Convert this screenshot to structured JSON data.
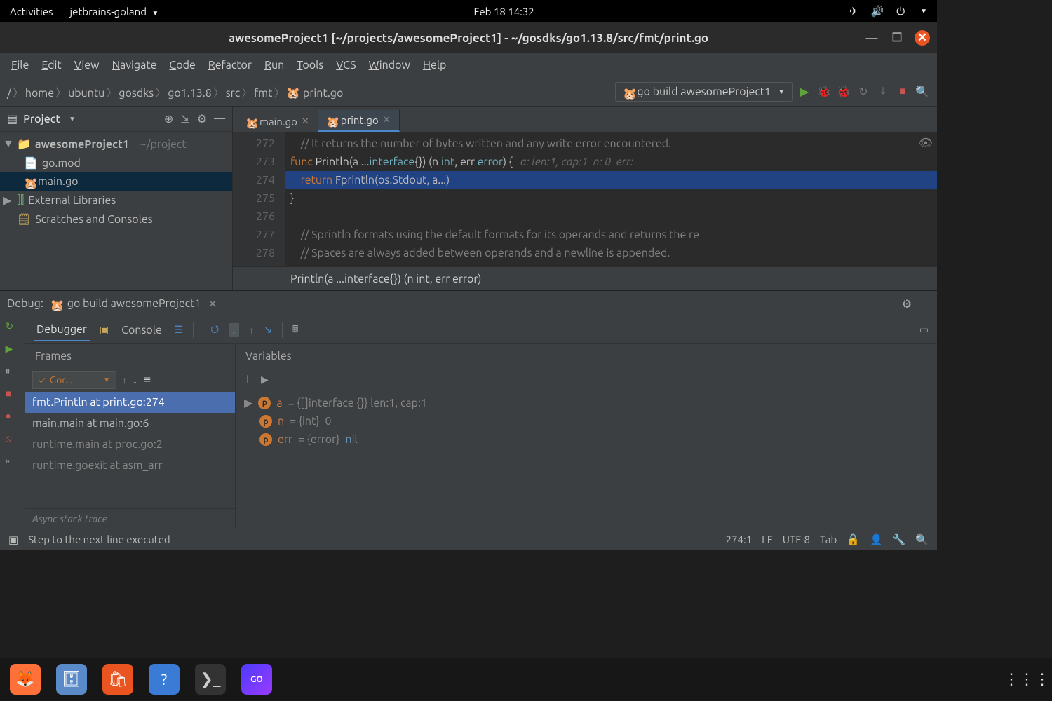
{
  "gnome": {
    "activities": "Activities",
    "app": "jetbrains-goland",
    "clock": "Feb 18  14:32"
  },
  "window": {
    "title": "awesomeProject1 [~/projects/awesomeProject1] - ~/gosdks/go1.13.8/src/fmt/print.go"
  },
  "menu": [
    "File",
    "Edit",
    "View",
    "Navigate",
    "Code",
    "Refactor",
    "Run",
    "Tools",
    "VCS",
    "Window",
    "Help"
  ],
  "breadcrumbs": [
    "/",
    "home",
    "ubuntu",
    "gosdks",
    "go1.13.8",
    "src",
    "fmt",
    "print.go"
  ],
  "runConfig": "go build awesomeProject1",
  "projectPanel": {
    "title": "Project"
  },
  "tree": {
    "root": "awesomeProject1",
    "rootPath": "~/project",
    "files": [
      "go.mod",
      "main.go"
    ],
    "extLib": "External Libraries",
    "scratches": "Scratches and Consoles"
  },
  "tabs": [
    {
      "name": "main.go",
      "active": false
    },
    {
      "name": "print.go",
      "active": true
    }
  ],
  "code": {
    "lines": [
      {
        "n": 272,
        "text": "    // It returns the number of bytes written and any write error encountered.",
        "cls": "k-comment"
      },
      {
        "n": 273,
        "html": "<span class='k-key'>func</span> <span class='k-func'>Println</span>(a ...<span class='k-type'>interface</span>{}) (n <span class='k-type'>int</span>, err <span class='k-type'>error</span>) {   <span class='k-hint'>a: len:1, cap:1  n: 0  err:</span>"
      },
      {
        "n": 274,
        "hl": true,
        "html": "    <span class='k-key'>return</span> Fprintln(os.Stdout, a...)"
      },
      {
        "n": 275,
        "text": "}"
      },
      {
        "n": 276,
        "text": ""
      },
      {
        "n": 277,
        "text": "    // Sprintln formats using the default formats for its operands and returns the re",
        "cls": "k-comment"
      },
      {
        "n": 278,
        "text": "    // Spaces are always added between operands and a newline is appended.",
        "cls": "k-comment"
      }
    ],
    "breadcrumb": "Println(a ...interface{}) (n int, err error)"
  },
  "debug": {
    "title": "Debug:",
    "config": "go build awesomeProject1",
    "tabs": {
      "debugger": "Debugger",
      "console": "Console"
    },
    "framesTitle": "Frames",
    "varsTitle": "Variables",
    "threadSel": "Gor...",
    "frames": [
      {
        "label": "fmt.Println at print.go:274",
        "sel": true
      },
      {
        "label": "main.main at main.go:6"
      },
      {
        "label": "runtime.main at proc.go:2",
        "muted": true
      },
      {
        "label": "runtime.goexit at asm_arr",
        "muted": true
      }
    ],
    "async": "Async stack trace",
    "vars": [
      {
        "name": "a",
        "rest": " = {[]interface {}} len:1, cap:1",
        "expand": true
      },
      {
        "name": "n",
        "typePart": " = {int} ",
        "val": "0"
      },
      {
        "name": "err",
        "typePart": " = {error} ",
        "nil": "nil"
      }
    ]
  },
  "status": {
    "msg": "Step to the next line executed",
    "pos": "274:1",
    "lf": "LF",
    "enc": "UTF-8",
    "tab": "Tab"
  }
}
